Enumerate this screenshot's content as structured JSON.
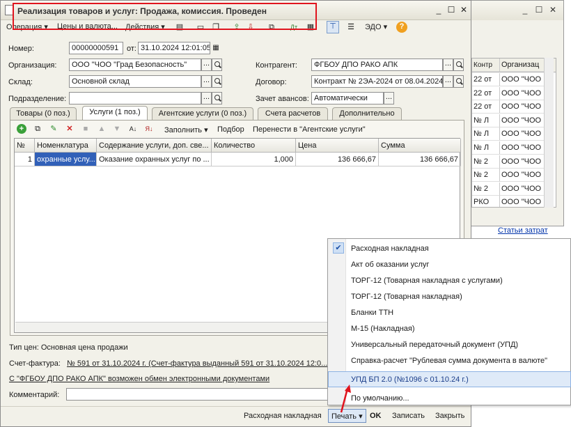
{
  "bg_window": {
    "headers": [
      "Контр",
      "Организац"
    ],
    "rows": [
      [
        "22 от",
        "ООО \"ЧОО"
      ],
      [
        "22 от",
        "ООО \"ЧОО"
      ],
      [
        "22 от",
        "ООО \"ЧОО"
      ],
      [
        "№ Л",
        "ООО \"ЧОО"
      ],
      [
        "№ Л",
        "ООО \"ЧОО"
      ],
      [
        "№ Л",
        "ООО \"ЧОО"
      ],
      [
        "№ 2",
        "ООО \"ЧОО"
      ],
      [
        "№ 2",
        "ООО \"ЧОО"
      ],
      [
        "№ 2",
        "ООО \"ЧОО"
      ],
      [
        "РКО",
        "ООО \"ЧОО"
      ]
    ],
    "link": "Статьи затрат"
  },
  "window": {
    "title": "Реализация товаров и услуг: Продажа, комиссия. Проведен"
  },
  "toolbar": {
    "operation": "Операция",
    "prices": "Цены и валюта...",
    "actions": "Действия",
    "edo": "ЭДО"
  },
  "header": {
    "number_label": "Номер:",
    "number_value": "00000000591",
    "date_label": "от:",
    "date_value": "31.10.2024 12:01:05",
    "org_label": "Организация:",
    "org_value": "ООО \"ЧОО \"Град Безопасность\"",
    "warehouse_label": "Склад:",
    "warehouse_value": "Основной склад",
    "division_label": "Подразделение:",
    "division_value": "",
    "counterparty_label": "Контрагент:",
    "counterparty_value": "ФГБОУ ДПО РАКО АПК",
    "contract_label": "Договор:",
    "contract_value": "Контракт № 2ЭА-2024 от 08.04.2024",
    "advance_label": "Зачет авансов:",
    "advance_value": "Автоматически"
  },
  "tabs": [
    "Товары (0 поз.)",
    "Услуги (1 поз.)",
    "Агентские услуги (0 поз.)",
    "Счета расчетов",
    "Дополнительно"
  ],
  "tab_toolbar": {
    "fill": "Заполнить",
    "pick": "Подбор",
    "move": "Перенести в \"Агентские услуги\""
  },
  "grid": {
    "headers": [
      "№",
      "Номенклатура",
      "Содержание услуги, доп. све...",
      "Количество",
      "Цена",
      "Сумма"
    ],
    "rows": [
      [
        "1",
        "охранные услу...",
        "Оказание охранных услуг по ...",
        "1,000",
        "136 666,67",
        "136 666,67"
      ]
    ]
  },
  "footer": {
    "price_type": "Тип цен: Основная цена продажи",
    "invoice_label": "Счет-фактура:",
    "invoice_link": "№ 591 от 31.10.2024 г. (Счет-фактура выданный 591 от 31.10.2024 12:0...",
    "edo_link": "С \"ФГБОУ ДПО РАКО АПК\" возможен обмен электронными документами",
    "comment_label": "Комментарий:",
    "comment_value": ""
  },
  "print_menu": {
    "items": [
      "Расходная накладная",
      "Акт об оказании услуг",
      "ТОРГ-12 (Товарная накладная с услугами)",
      "ТОРГ-12 (Товарная накладная)",
      "Бланки ТТН",
      "М-15 (Накладная)",
      "Универсальный передаточный документ (УПД)",
      "Справка-расчет \"Рублевая сумма документа в валюте\"",
      "УПД БП 2.0 (№1096 с 01.10.24 г.)",
      "По умолчанию..."
    ]
  },
  "buttons": {
    "print_default": "Расходная накладная",
    "print": "Печать",
    "ok": "OK",
    "save": "Записать",
    "close": "Закрыть"
  },
  "colors": {
    "highlight_box": "#e0141e",
    "arrow": "#e0141e",
    "menu_highlight": "#dfeaf8"
  }
}
